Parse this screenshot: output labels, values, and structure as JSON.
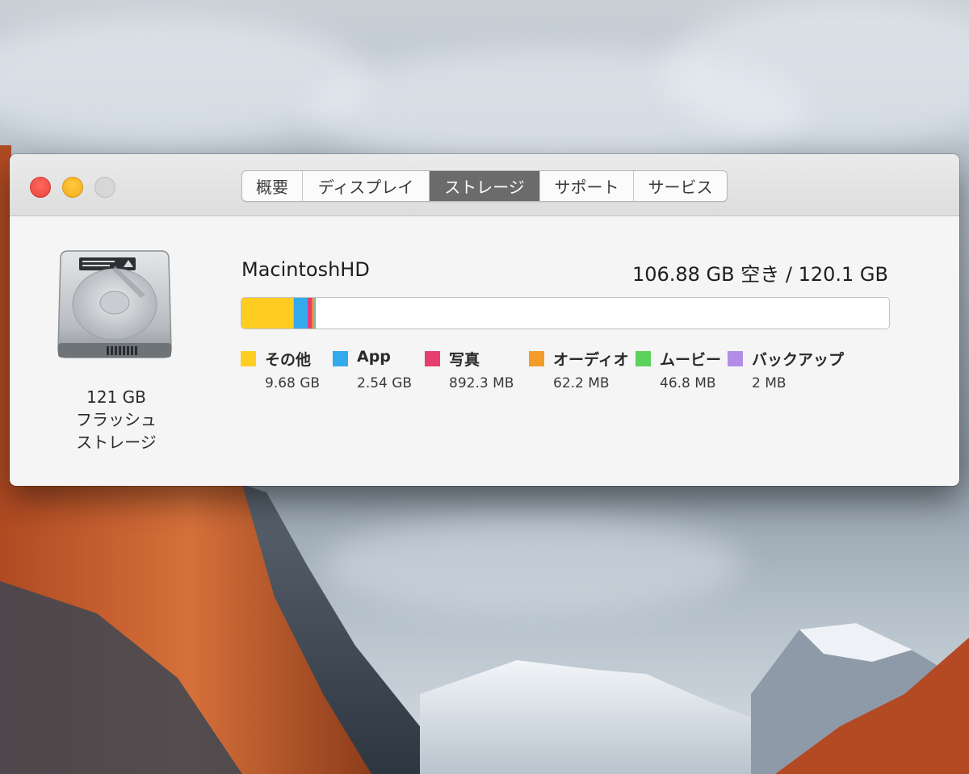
{
  "window": {
    "tabs": [
      {
        "label": "概要",
        "active": false
      },
      {
        "label": "ディスプレイ",
        "active": false
      },
      {
        "label": "ストレージ",
        "active": true
      },
      {
        "label": "サポート",
        "active": false
      },
      {
        "label": "サービス",
        "active": false
      }
    ]
  },
  "disk": {
    "capacity": "121 GB",
    "type_line1": "フラッシュ",
    "type_line2": "ストレージ"
  },
  "volume": {
    "name": "MacintoshHD",
    "free_text": "106.88 GB 空き / 120.1 GB",
    "total_gb": 120.1
  },
  "legend": [
    {
      "label": "その他",
      "size": "9.68 GB",
      "gb": 9.68,
      "color": "#ffcc22"
    },
    {
      "label": "App",
      "size": "2.54 GB",
      "gb": 2.54,
      "color": "#33aaee"
    },
    {
      "label": "写真",
      "size": "892.3 MB",
      "gb": 0.8923,
      "color": "#e63e6d"
    },
    {
      "label": "オーディオ",
      "size": "62.2 MB",
      "gb": 0.0622,
      "color": "#f39c2a"
    },
    {
      "label": "ムービー",
      "size": "46.8 MB",
      "gb": 0.0468,
      "color": "#5cd15c"
    },
    {
      "label": "バックアップ",
      "size": "2 MB",
      "gb": 0.002,
      "color": "#b28ce8"
    }
  ]
}
